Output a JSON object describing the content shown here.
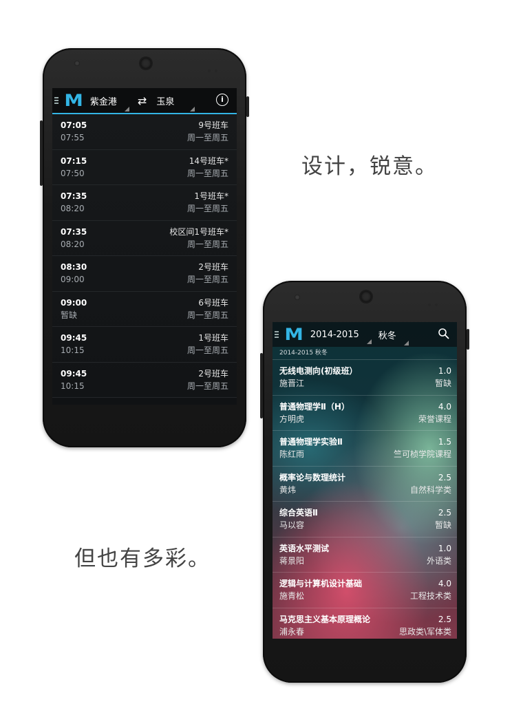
{
  "headlines": {
    "top": "设计，锐意。",
    "bottom": "但也有多彩。"
  },
  "phone1": {
    "actionbar": {
      "menu_icon": "menu-icon",
      "logo": "M",
      "from_stop": "紫金港",
      "swap_icon": "swap-arrows-icon",
      "to_stop": "玉泉",
      "info_icon": "info-icon",
      "accent": "#33b5e5"
    },
    "rows": [
      {
        "depart": "07:05",
        "arrive": "07:55",
        "bus": "9号班车",
        "days": "周一至周五"
      },
      {
        "depart": "07:15",
        "arrive": "07:50",
        "bus": "14号班车*",
        "days": "周一至周五"
      },
      {
        "depart": "07:35",
        "arrive": "08:20",
        "bus": "1号班车*",
        "days": "周一至周五"
      },
      {
        "depart": "07:35",
        "arrive": "08:20",
        "bus": "校区间1号班车*",
        "days": "周一至周五"
      },
      {
        "depart": "08:30",
        "arrive": "09:00",
        "bus": "2号班车",
        "days": "周一至周五"
      },
      {
        "depart": "09:00",
        "arrive": "暂缺",
        "bus": "6号班车",
        "days": "周一至周五"
      },
      {
        "depart": "09:45",
        "arrive": "10:15",
        "bus": "1号班车",
        "days": "周一至周五"
      },
      {
        "depart": "09:45",
        "arrive": "10:15",
        "bus": "2号班车",
        "days": "周一至周五"
      }
    ]
  },
  "phone2": {
    "actionbar": {
      "menu_icon": "menu-icon",
      "logo": "M",
      "year": "2014-2015",
      "term": "秋冬",
      "search_icon": "search-icon"
    },
    "subheader": "2014-2015 秋冬",
    "courses": [
      {
        "name": "无线电测向(初级班）",
        "teacher": "施晋江",
        "credit": "1.0",
        "category": "暂缺"
      },
      {
        "name": "普通物理学Ⅱ（H）",
        "teacher": "方明虎",
        "credit": "4.0",
        "category": "荣誉课程"
      },
      {
        "name": "普通物理学实验Ⅱ",
        "teacher": "陈红雨",
        "credit": "1.5",
        "category": "竺可桢学院课程"
      },
      {
        "name": "概率论与数理统计",
        "teacher": "黄炜",
        "credit": "2.5",
        "category": "自然科学类"
      },
      {
        "name": "综合英语Ⅱ",
        "teacher": "马以容",
        "credit": "2.5",
        "category": "暂缺"
      },
      {
        "name": "英语水平测试",
        "teacher": "蒋景阳",
        "credit": "1.0",
        "category": "外语类"
      },
      {
        "name": "逻辑与计算机设计基础",
        "teacher": "施青松",
        "credit": "4.0",
        "category": "工程技术类"
      },
      {
        "name": "马克思主义基本原理概论",
        "teacher": "浦永春",
        "credit": "2.5",
        "category": "思政类\\军体类"
      }
    ]
  }
}
